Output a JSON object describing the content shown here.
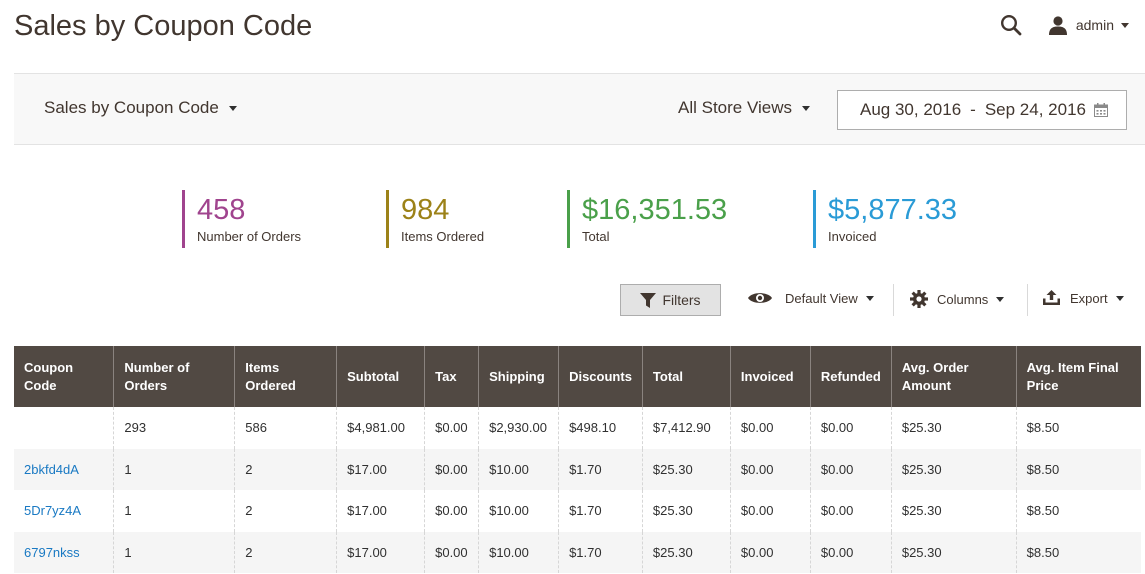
{
  "page": {
    "title": "Sales by Coupon Code"
  },
  "header": {
    "user_name": "admin"
  },
  "toolbar": {
    "report_label": "Sales by Coupon Code",
    "store_label": "All Store Views",
    "date_from": "Aug 30, 2016",
    "date_sep": "-",
    "date_to": "Sep 24, 2016"
  },
  "metrics": [
    {
      "value": "458",
      "label": "Number of Orders",
      "color": "#a0448e"
    },
    {
      "value": "984",
      "label": "Items Ordered",
      "color": "#9c8218"
    },
    {
      "value": "$16,351.53",
      "label": "Total",
      "color": "#4aa04a"
    },
    {
      "value": "$5,877.33",
      "label": "Invoiced",
      "color": "#2a9bd6"
    }
  ],
  "grid_tools": {
    "filters_label": "Filters",
    "view_label": "Default View",
    "columns_label": "Columns",
    "export_label": "Export"
  },
  "table": {
    "headers": [
      "Coupon Code",
      "Number of Orders",
      "Items Ordered",
      "Subtotal",
      "Tax",
      "Shipping",
      "Discounts",
      "Total",
      "Invoiced",
      "Refunded",
      "Avg. Order Amount",
      "Avg. Item Final Price"
    ],
    "rows": [
      [
        "",
        "293",
        "586",
        "$4,981.00",
        "$0.00",
        "$2,930.00",
        "$498.10",
        "$7,412.90",
        "$0.00",
        "$0.00",
        "$25.30",
        "$8.50"
      ],
      [
        "2bkfd4dA",
        "1",
        "2",
        "$17.00",
        "$0.00",
        "$10.00",
        "$1.70",
        "$25.30",
        "$0.00",
        "$0.00",
        "$25.30",
        "$8.50"
      ],
      [
        "5Dr7yz4A",
        "1",
        "2",
        "$17.00",
        "$0.00",
        "$10.00",
        "$1.70",
        "$25.30",
        "$0.00",
        "$0.00",
        "$25.30",
        "$8.50"
      ],
      [
        "6797nkss",
        "1",
        "2",
        "$17.00",
        "$0.00",
        "$10.00",
        "$1.70",
        "$25.30",
        "$0.00",
        "$0.00",
        "$25.30",
        "$8.50"
      ]
    ]
  },
  "icons": [
    "search-icon",
    "user-icon",
    "chevron-down-icon",
    "calendar-icon",
    "filter-icon",
    "eye-icon",
    "gear-icon",
    "export-icon"
  ]
}
